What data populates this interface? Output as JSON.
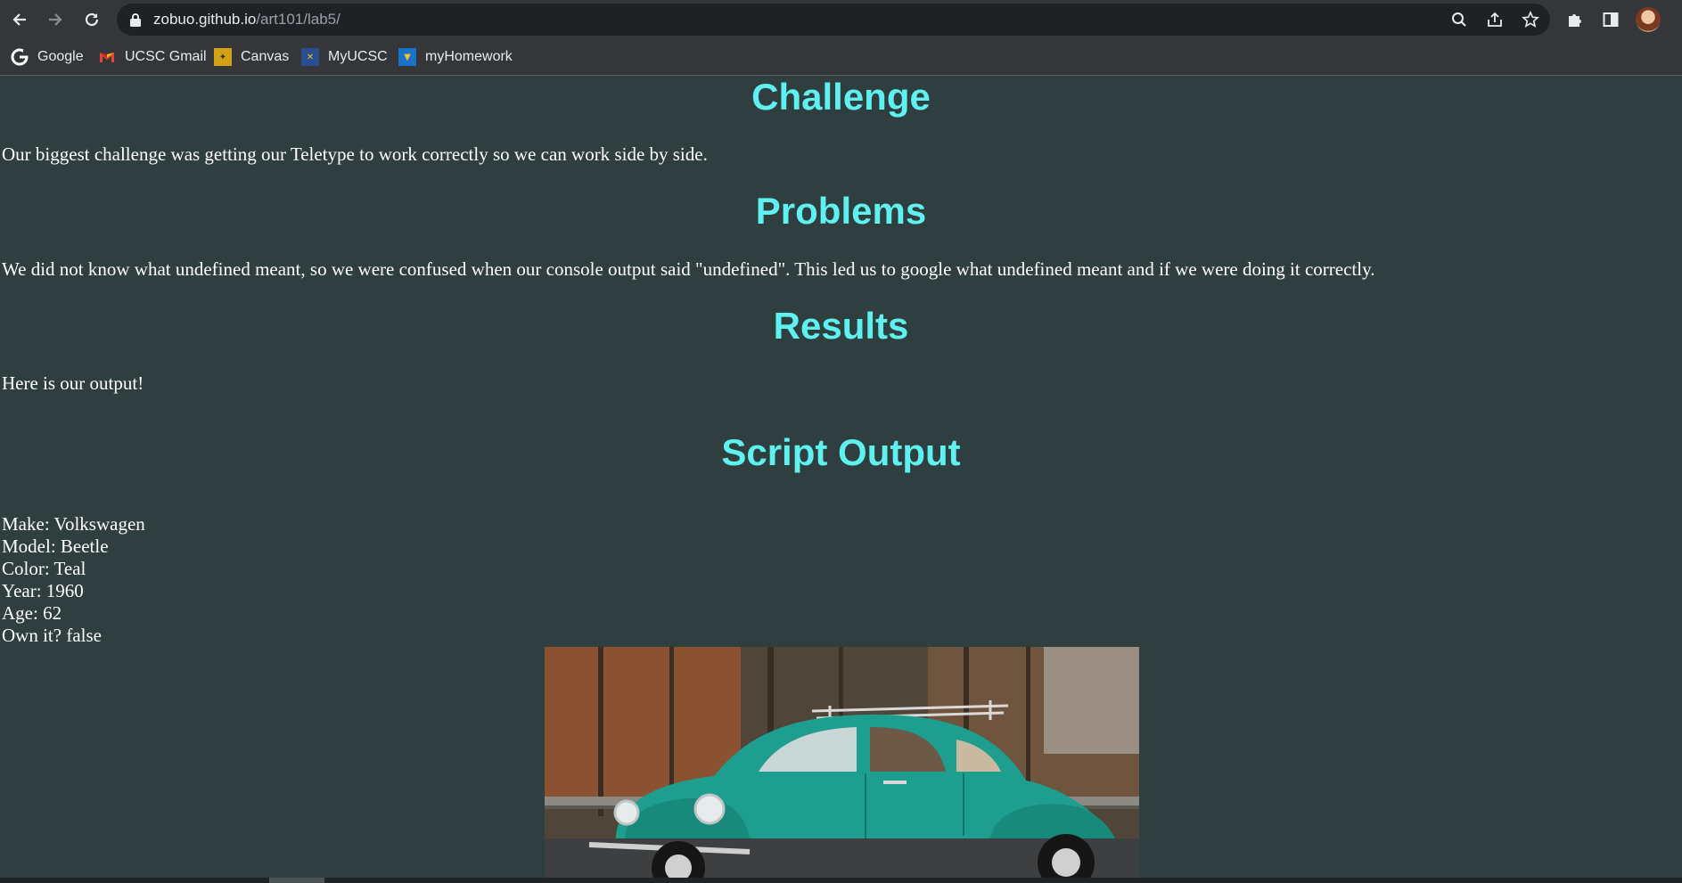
{
  "browser": {
    "url_host": "zobuo.github.io",
    "url_path": "/art101/lab5/",
    "icons": {
      "back": "arrow-left-icon",
      "forward": "arrow-right-icon",
      "reload": "reload-icon",
      "lock": "lock-icon",
      "zoom": "zoom-icon",
      "share": "share-icon",
      "bookmark": "star-icon",
      "extensions": "puzzle-icon",
      "side_panel": "side-panel-icon"
    }
  },
  "bookmarks": [
    {
      "label": "Google",
      "icon": "google-icon"
    },
    {
      "label": "UCSC Gmail",
      "icon": "gmail-icon"
    },
    {
      "label": "Canvas",
      "icon": "canvas-icon"
    },
    {
      "label": "MyUCSC",
      "icon": "myucsc-icon"
    },
    {
      "label": "myHomework",
      "icon": "myhomework-icon"
    }
  ],
  "page": {
    "challenge_heading": "Challenge",
    "challenge_text": "Our biggest challenge was getting our Teletype to work correctly so we can work side by side.",
    "problems_heading": "Problems",
    "problems_text": "We did not know what undefined meant, so we were confused when our console output said \"undefined\". This led us to google what undefined meant and if we were doing it correctly.",
    "results_heading": "Results",
    "results_text": "Here is our output!",
    "script_heading": "Script Output",
    "output_lines": [
      "Make: Volkswagen",
      "Model: Beetle",
      "Color: Teal",
      "Year: 1960",
      "Age: 62",
      "Own it? false"
    ]
  },
  "colors": {
    "page_background": "#2f3e3f",
    "heading": "#5ff0f0",
    "text": "#ffffff",
    "car": "#1e9e8e"
  }
}
